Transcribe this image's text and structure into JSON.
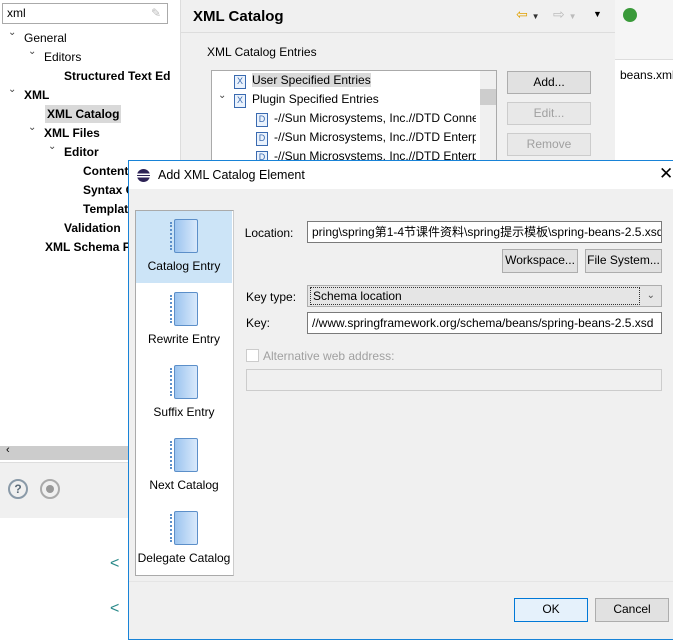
{
  "filter": {
    "value": "xml"
  },
  "tree": [
    {
      "label": "General",
      "level": 0,
      "expanded": true,
      "bold": false
    },
    {
      "label": "Editors",
      "level": 1,
      "expanded": true,
      "bold": false
    },
    {
      "label": "Structured Text Ed",
      "level": 3,
      "bold": true
    },
    {
      "label": "XML",
      "level": 0,
      "expanded": true,
      "bold": true
    },
    {
      "label": "XML Catalog",
      "level": 2,
      "bold": true,
      "selected": true
    },
    {
      "label": "XML Files",
      "level": 1,
      "expanded": true,
      "bold": true
    },
    {
      "label": "Editor",
      "level": 2,
      "expanded": true,
      "bold": true
    },
    {
      "label": "Content",
      "level": 4,
      "bold": true
    },
    {
      "label": "Syntax C",
      "level": 4,
      "bold": true
    },
    {
      "label": "Templat",
      "level": 4,
      "bold": true
    },
    {
      "label": "Validation",
      "level": 3,
      "bold": true
    },
    {
      "label": "XML Schema Fi",
      "level": 2,
      "bold": true
    }
  ],
  "pref": {
    "title": "XML Catalog",
    "group_label": "XML Catalog Entries",
    "entries": [
      "User Specified Entries",
      "Plugin Specified Entries",
      "-//Sun Microsystems, Inc.//DTD Conne",
      "-//Sun Microsystems, Inc.//DTD Enterp",
      "-//Sun Microsystems, Inc.//DTD Enterp"
    ],
    "add": "Add...",
    "edit": "Edit...",
    "remove": "Remove"
  },
  "editor": {
    "tab": "beans.xml"
  },
  "dialog": {
    "title": "Add XML Catalog Element",
    "nav": [
      "Catalog Entry",
      "Rewrite Entry",
      "Suffix Entry",
      "Next Catalog",
      "Delegate Catalog"
    ],
    "location_label": "Location:",
    "location_value": "pring\\spring第1-4节课件资料\\spring提示模板\\spring-beans-2.5.xsd",
    "workspace": "Workspace...",
    "filesystem": "File System...",
    "keytype_label": "Key type:",
    "keytype_value": "Schema location",
    "key_label": "Key:",
    "key_value": "//www.springframework.org/schema/beans/spring-beans-2.5.xsd",
    "alt_label": "Alternative web address:",
    "alt_value": "",
    "ok": "OK",
    "cancel": "Cancel"
  },
  "colors": {
    "accent": "#1883d7",
    "selected": "#cce4f7"
  }
}
